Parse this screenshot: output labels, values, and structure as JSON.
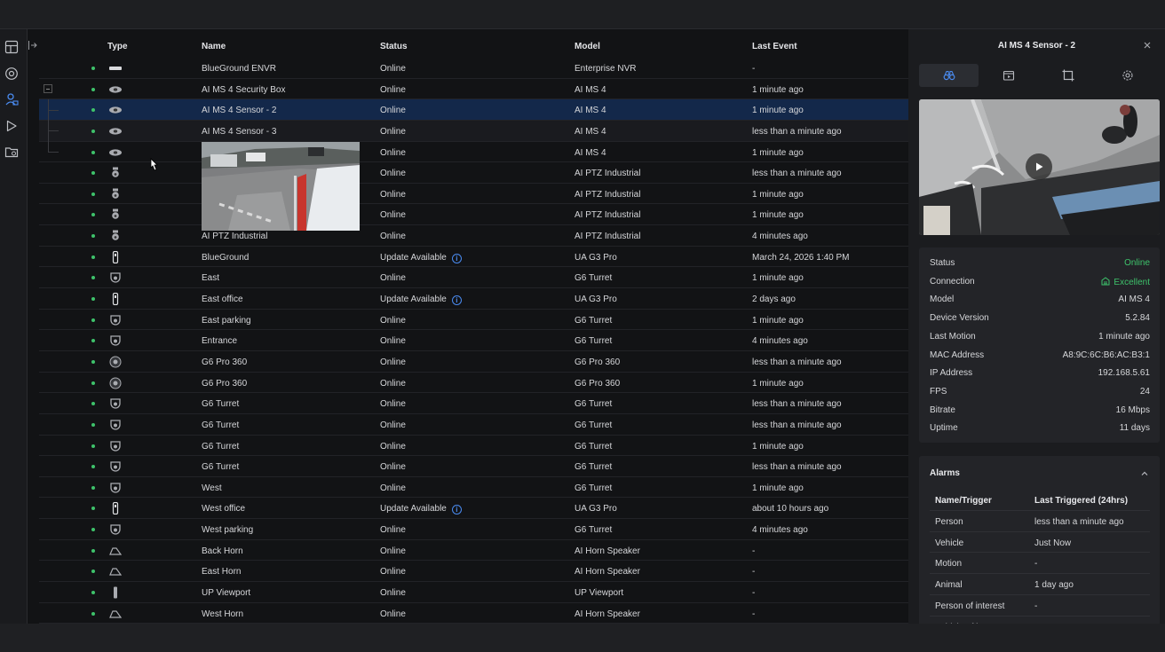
{
  "table": {
    "headers": {
      "type": "Type",
      "name": "Name",
      "status": "Status",
      "model": "Model",
      "last_event": "Last Event"
    },
    "rows": [
      {
        "icon": "nvr-icon",
        "name": "BlueGround ENVR",
        "status": "Online",
        "model": "Enterprise NVR",
        "last_event": "-",
        "update": false
      },
      {
        "icon": "sensor-icon",
        "name": "AI MS 4 Security Box",
        "status": "Online",
        "model": "AI MS 4",
        "last_event": "1 minute ago",
        "update": false
      },
      {
        "icon": "sensor-icon",
        "name": "AI MS 4 Sensor - 2",
        "status": "Online",
        "model": "AI MS 4",
        "last_event": "1 minute ago",
        "update": false
      },
      {
        "icon": "sensor-icon",
        "name": "AI MS 4 Sensor - 3",
        "status": "Online",
        "model": "AI MS 4",
        "last_event": "less than a minute ago",
        "update": false
      },
      {
        "icon": "sensor-icon",
        "name": "",
        "status": "Online",
        "model": "AI MS 4",
        "last_event": "1 minute ago",
        "update": false
      },
      {
        "icon": "ptz-icon",
        "name": "",
        "status": "Online",
        "model": "AI PTZ Industrial",
        "last_event": "less than a minute ago",
        "update": false
      },
      {
        "icon": "ptz-icon",
        "name": "",
        "status": "Online",
        "model": "AI PTZ Industrial",
        "last_event": "1 minute ago",
        "update": false
      },
      {
        "icon": "ptz-icon",
        "name": "",
        "status": "Online",
        "model": "AI PTZ Industrial",
        "last_event": "1 minute ago",
        "update": false
      },
      {
        "icon": "ptz-icon",
        "name": "AI PTZ Industrial",
        "status": "Online",
        "model": "AI PTZ Industrial",
        "last_event": "4 minutes ago",
        "update": false
      },
      {
        "icon": "bullet-icon",
        "name": "BlueGround",
        "status": "Update Available",
        "model": "UA G3 Pro",
        "last_event": "March 24, 2026 1:40 PM",
        "update": true
      },
      {
        "icon": "turret-icon",
        "name": "East",
        "status": "Online",
        "model": "G6 Turret",
        "last_event": "1 minute ago",
        "update": false
      },
      {
        "icon": "bullet-icon",
        "name": "East office",
        "status": "Update Available",
        "model": "UA G3 Pro",
        "last_event": "2 days ago",
        "update": true
      },
      {
        "icon": "turret-icon",
        "name": "East parking",
        "status": "Online",
        "model": "G6 Turret",
        "last_event": "1 minute ago",
        "update": false
      },
      {
        "icon": "turret-icon",
        "name": "Entrance",
        "status": "Online",
        "model": "G6 Turret",
        "last_event": "4 minutes ago",
        "update": false
      },
      {
        "icon": "dome360-icon",
        "name": "G6 Pro 360",
        "status": "Online",
        "model": "G6 Pro 360",
        "last_event": "less than a minute ago",
        "update": false
      },
      {
        "icon": "dome360-icon",
        "name": "G6 Pro 360",
        "status": "Online",
        "model": "G6 Pro 360",
        "last_event": "1 minute ago",
        "update": false
      },
      {
        "icon": "turret-icon",
        "name": "G6 Turret",
        "status": "Online",
        "model": "G6 Turret",
        "last_event": "less than a minute ago",
        "update": false
      },
      {
        "icon": "turret-icon",
        "name": "G6 Turret",
        "status": "Online",
        "model": "G6 Turret",
        "last_event": "less than a minute ago",
        "update": false
      },
      {
        "icon": "turret-icon",
        "name": "G6 Turret",
        "status": "Online",
        "model": "G6 Turret",
        "last_event": "1 minute ago",
        "update": false
      },
      {
        "icon": "turret-icon",
        "name": "G6 Turret",
        "status": "Online",
        "model": "G6 Turret",
        "last_event": "less than a minute ago",
        "update": false
      },
      {
        "icon": "turret-icon",
        "name": "West",
        "status": "Online",
        "model": "G6 Turret",
        "last_event": "1 minute ago",
        "update": false
      },
      {
        "icon": "bullet-icon",
        "name": "West office",
        "status": "Update Available",
        "model": "UA G3 Pro",
        "last_event": "about 10 hours ago",
        "update": true
      },
      {
        "icon": "turret-icon",
        "name": "West parking",
        "status": "Online",
        "model": "G6 Turret",
        "last_event": "4 minutes ago",
        "update": false
      },
      {
        "icon": "horn-icon",
        "name": "Back Horn",
        "status": "Online",
        "model": "AI Horn Speaker",
        "last_event": "-",
        "update": false
      },
      {
        "icon": "horn-icon",
        "name": "East Horn",
        "status": "Online",
        "model": "AI Horn Speaker",
        "last_event": "-",
        "update": false
      },
      {
        "icon": "viewport-icon",
        "name": "UP Viewport",
        "status": "Online",
        "model": "UP Viewport",
        "last_event": "-",
        "update": false
      },
      {
        "icon": "horn-icon",
        "name": "West Horn",
        "status": "Online",
        "model": "AI Horn Speaker",
        "last_event": "-",
        "update": false
      }
    ],
    "selected_index": 2,
    "hover_index": 3
  },
  "panel": {
    "title": "AI MS 4 Sensor - 2",
    "tabs": [
      "binoculars-icon",
      "media-icon",
      "crop-icon",
      "gear-icon"
    ],
    "details": [
      {
        "label": "Status",
        "value": "Online",
        "green": true
      },
      {
        "label": "Connection",
        "value": "Excellent",
        "green": true
      },
      {
        "label": "Model",
        "value": "AI MS 4",
        "green": false
      },
      {
        "label": "Device Version",
        "value": "5.2.84",
        "green": false
      },
      {
        "label": "Last Motion",
        "value": "1 minute ago",
        "green": false
      },
      {
        "label": "MAC Address",
        "value": "A8:9C:6C:B6:AC:B3:1",
        "green": false
      },
      {
        "label": "IP Address",
        "value": "192.168.5.61",
        "green": false
      },
      {
        "label": "FPS",
        "value": "24",
        "green": false
      },
      {
        "label": "Bitrate",
        "value": "16 Mbps",
        "green": false
      },
      {
        "label": "Uptime",
        "value": "11 days",
        "green": false
      }
    ],
    "alarms": {
      "title": "Alarms",
      "header": {
        "name": "Name/Trigger",
        "last": "Last Triggered (24hrs)"
      },
      "rows": [
        {
          "name": "Person",
          "last": "less than a minute ago"
        },
        {
          "name": "Vehicle",
          "last": "Just Now"
        },
        {
          "name": "Motion",
          "last": "-"
        },
        {
          "name": "Animal",
          "last": "1 day ago"
        },
        {
          "name": "Person of interest",
          "last": "-"
        },
        {
          "name": "Vehicle of interest",
          "last": "-"
        }
      ]
    }
  },
  "colors": {
    "online_dot": "#3ec26b",
    "accent_blue": "#4a8bf0",
    "selected_row": "#13284a"
  }
}
